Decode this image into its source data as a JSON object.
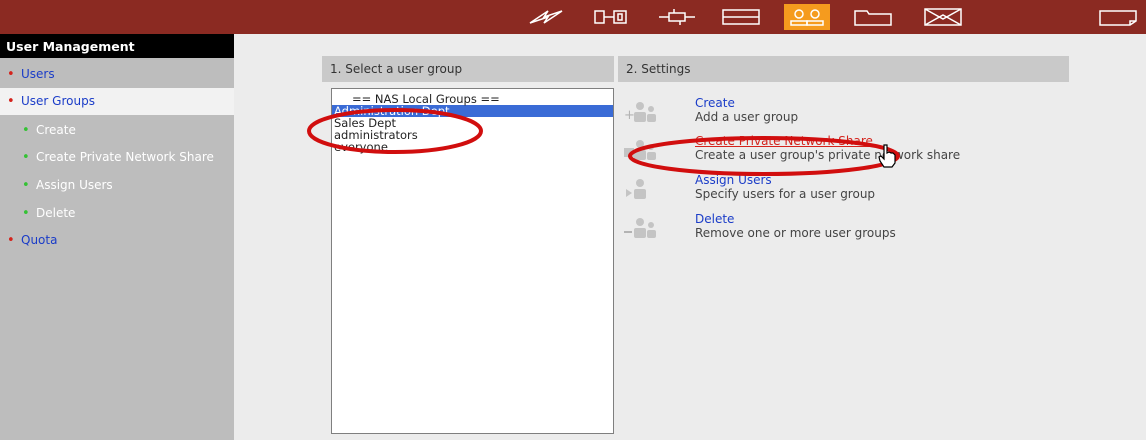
{
  "colors": {
    "topbar": "#8b2a22",
    "active_tab": "#f59b1e",
    "link": "#1a3cc8",
    "bullet_red": "#d4231c",
    "bullet_green": "#34c234",
    "annotation": "#d10e0e"
  },
  "topbar": {
    "icons": [
      {
        "name": "quick-config-icon",
        "active": false
      },
      {
        "name": "system-settings-icon",
        "active": false
      },
      {
        "name": "network-icon",
        "active": false
      },
      {
        "name": "disk-icon",
        "active": false
      },
      {
        "name": "user-management-icon",
        "active": true
      },
      {
        "name": "network-share-icon",
        "active": false
      },
      {
        "name": "application-icon",
        "active": false
      },
      {
        "name": "backup-icon",
        "active": false
      }
    ]
  },
  "sidebar": {
    "title": "User Management",
    "items": [
      {
        "label": "Users",
        "level": "top"
      },
      {
        "label": "User Groups",
        "level": "top",
        "selected": true
      },
      {
        "label": "Create",
        "level": "sub"
      },
      {
        "label": "Create Private Network Share",
        "level": "sub"
      },
      {
        "label": "Assign Users",
        "level": "sub"
      },
      {
        "label": "Delete",
        "level": "sub"
      },
      {
        "label": "Quota",
        "level": "top"
      }
    ]
  },
  "main": {
    "col1_title": "1. Select a user group",
    "col2_title": "2. Settings",
    "groups": [
      "== NAS Local Groups ==",
      "Administration Dept",
      "Sales Dept",
      "administrators",
      "everyone"
    ],
    "selected_group": "Administration Dept",
    "settings": [
      {
        "title": "Create",
        "desc": "Add a user group",
        "icon": "add-group-icon"
      },
      {
        "title": "Create Private Network Share",
        "desc": "Create a user group's private network share",
        "icon": "group-share-icon",
        "highlighted": true
      },
      {
        "title": "Assign Users",
        "desc": "Specify users for a user group",
        "icon": "assign-users-icon"
      },
      {
        "title": "Delete",
        "desc": "Remove one or more user groups",
        "icon": "delete-group-icon"
      }
    ]
  }
}
